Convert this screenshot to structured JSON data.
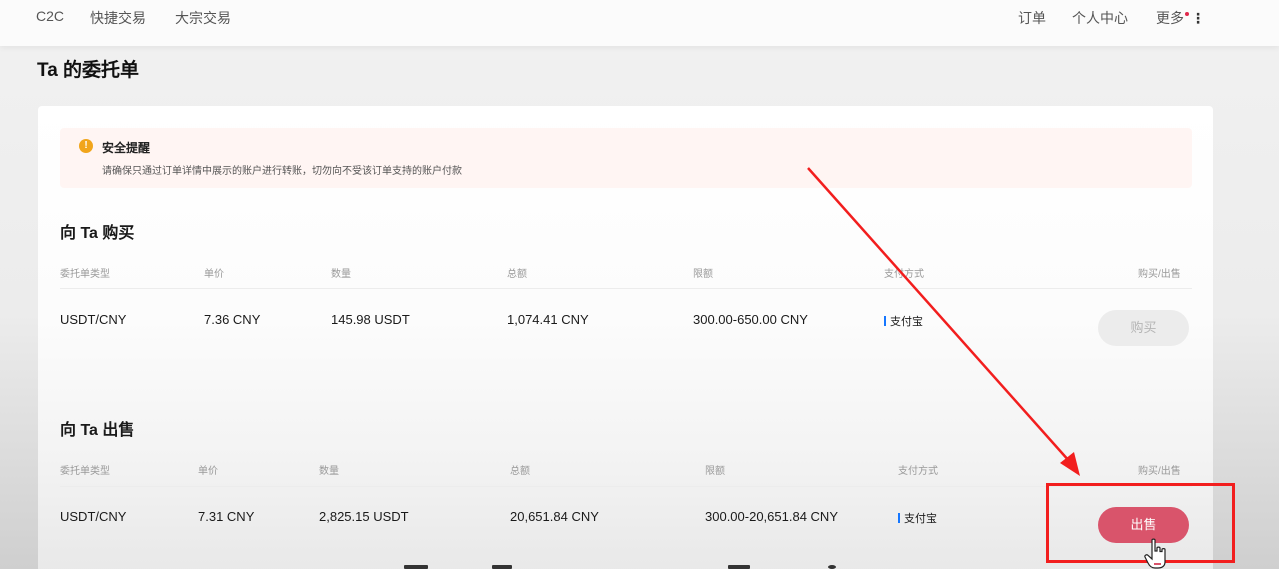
{
  "nav": {
    "left": [
      "C2C",
      "快捷交易",
      "大宗交易"
    ],
    "right": {
      "orders": "订单",
      "profile": "个人中心",
      "more": "更多"
    }
  },
  "page": {
    "title": "Ta 的委托单"
  },
  "alert": {
    "title": "安全提醒",
    "text": "请确保只通过订单详情中展示的账户进行转账，切勿向不受该订单支持的账户付款"
  },
  "buy_section": {
    "title": "向 Ta 购买",
    "headers": [
      "委托单类型",
      "单价",
      "数量",
      "总额",
      "限额",
      "支付方式",
      "购买/出售"
    ],
    "row": {
      "pair": "USDT/CNY",
      "price": "7.36 CNY",
      "quantity": "145.98 USDT",
      "total": "1,074.41 CNY",
      "limit": "300.00-650.00 CNY",
      "payment": "支付宝"
    },
    "button": "购买"
  },
  "sell_section": {
    "title": "向 Ta 出售",
    "headers": [
      "委托单类型",
      "单价",
      "数量",
      "总额",
      "限额",
      "支付方式",
      "购买/出售"
    ],
    "row": {
      "pair": "USDT/CNY",
      "price": "7.31 CNY",
      "quantity": "2,825.15 USDT",
      "total": "20,651.84 CNY",
      "limit": "300.00-20,651.84 CNY",
      "payment": "支付宝"
    },
    "button": "出售"
  },
  "colors": {
    "sell_button": "#d9546b",
    "annotation": "#f21e1e",
    "alipay": "#1677ff",
    "warning": "#f1a51b"
  },
  "icons": {
    "warning": "warning-icon",
    "more": "kebab-menu-icon",
    "cursor": "hand-pointer-icon"
  }
}
